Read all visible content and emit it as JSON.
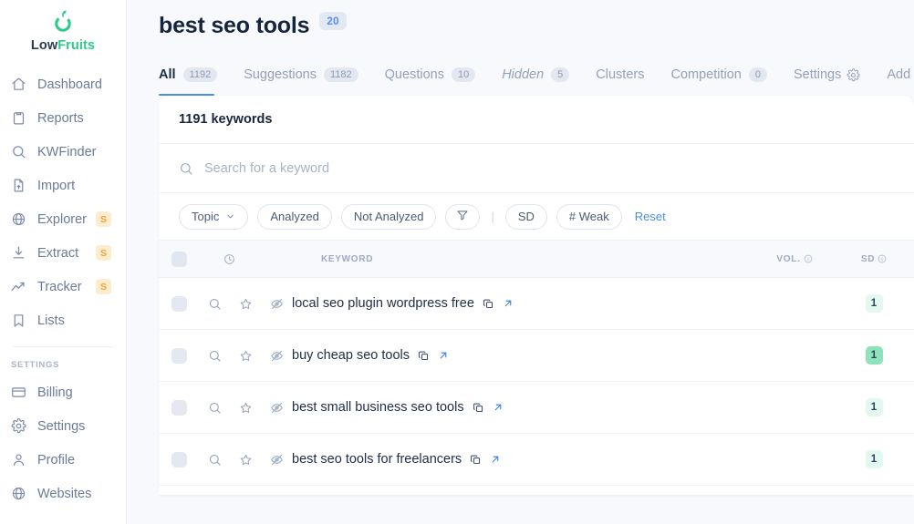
{
  "brand": {
    "name_part1": "Low",
    "name_part2": "Fruits",
    "logo_icon": "fruit-logo-icon",
    "green": "#2fc98a"
  },
  "sidebar": {
    "items": [
      {
        "label": "Dashboard",
        "icon": "home-icon",
        "badge": ""
      },
      {
        "label": "Reports",
        "icon": "clipboard-icon",
        "badge": ""
      },
      {
        "label": "KWFinder",
        "icon": "search-icon",
        "badge": ""
      },
      {
        "label": "Import",
        "icon": "file-import-icon",
        "badge": ""
      },
      {
        "label": "Explorer",
        "icon": "globe-icon",
        "badge": "S"
      },
      {
        "label": "Extract",
        "icon": "download-icon",
        "badge": "S"
      },
      {
        "label": "Tracker",
        "icon": "trending-up-icon",
        "badge": "S"
      },
      {
        "label": "Lists",
        "icon": "bookmark-icon",
        "badge": ""
      }
    ],
    "section_label": "SETTINGS",
    "settings_items": [
      {
        "label": "Billing",
        "icon": "credit-card-icon"
      },
      {
        "label": "Settings",
        "icon": "gear-icon"
      },
      {
        "label": "Profile",
        "icon": "user-icon"
      },
      {
        "label": "Websites",
        "icon": "globe-icon"
      }
    ]
  },
  "header": {
    "title": "best seo tools",
    "badge": "20"
  },
  "tabs": [
    {
      "label": "All",
      "count": "1192",
      "active": true,
      "italic": false,
      "icon": ""
    },
    {
      "label": "Suggestions",
      "count": "1182",
      "active": false,
      "italic": false,
      "icon": ""
    },
    {
      "label": "Questions",
      "count": "10",
      "active": false,
      "italic": false,
      "icon": ""
    },
    {
      "label": "Hidden",
      "count": "5",
      "active": false,
      "italic": true,
      "icon": ""
    },
    {
      "label": "Clusters",
      "count": "",
      "active": false,
      "italic": false,
      "icon": ""
    },
    {
      "label": "Competition",
      "count": "0",
      "active": false,
      "italic": false,
      "icon": ""
    },
    {
      "label": "Settings",
      "count": "",
      "active": false,
      "italic": false,
      "icon": "gear-icon"
    },
    {
      "label": "Add",
      "count": "",
      "active": false,
      "italic": false,
      "icon": "plus-circle-icon"
    }
  ],
  "card": {
    "keywords_count_label": "1191 keywords",
    "search_placeholder": "Search for a keyword",
    "search_value": "",
    "filters": {
      "topic": "Topic",
      "analyzed": "Analyzed",
      "not_analyzed": "Not Analyzed",
      "funnel_icon": "filter-funnel-icon",
      "separator": "|",
      "sd": "SD",
      "weak": "# Weak",
      "reset": "Reset"
    },
    "table": {
      "headers": {
        "keyword": "KEYWORD",
        "vol": "VOL.",
        "sd": "SD",
        "clock_icon": "clock-icon"
      },
      "rows": [
        {
          "keyword": "local seo plugin wordpress free",
          "vol": "",
          "sd": "1",
          "sd_strong": false
        },
        {
          "keyword": "buy cheap seo tools",
          "vol": "",
          "sd": "1",
          "sd_strong": true
        },
        {
          "keyword": "best small business seo tools",
          "vol": "",
          "sd": "1",
          "sd_strong": false
        },
        {
          "keyword": "best seo tools for freelancers",
          "vol": "",
          "sd": "1",
          "sd_strong": false
        }
      ]
    }
  }
}
